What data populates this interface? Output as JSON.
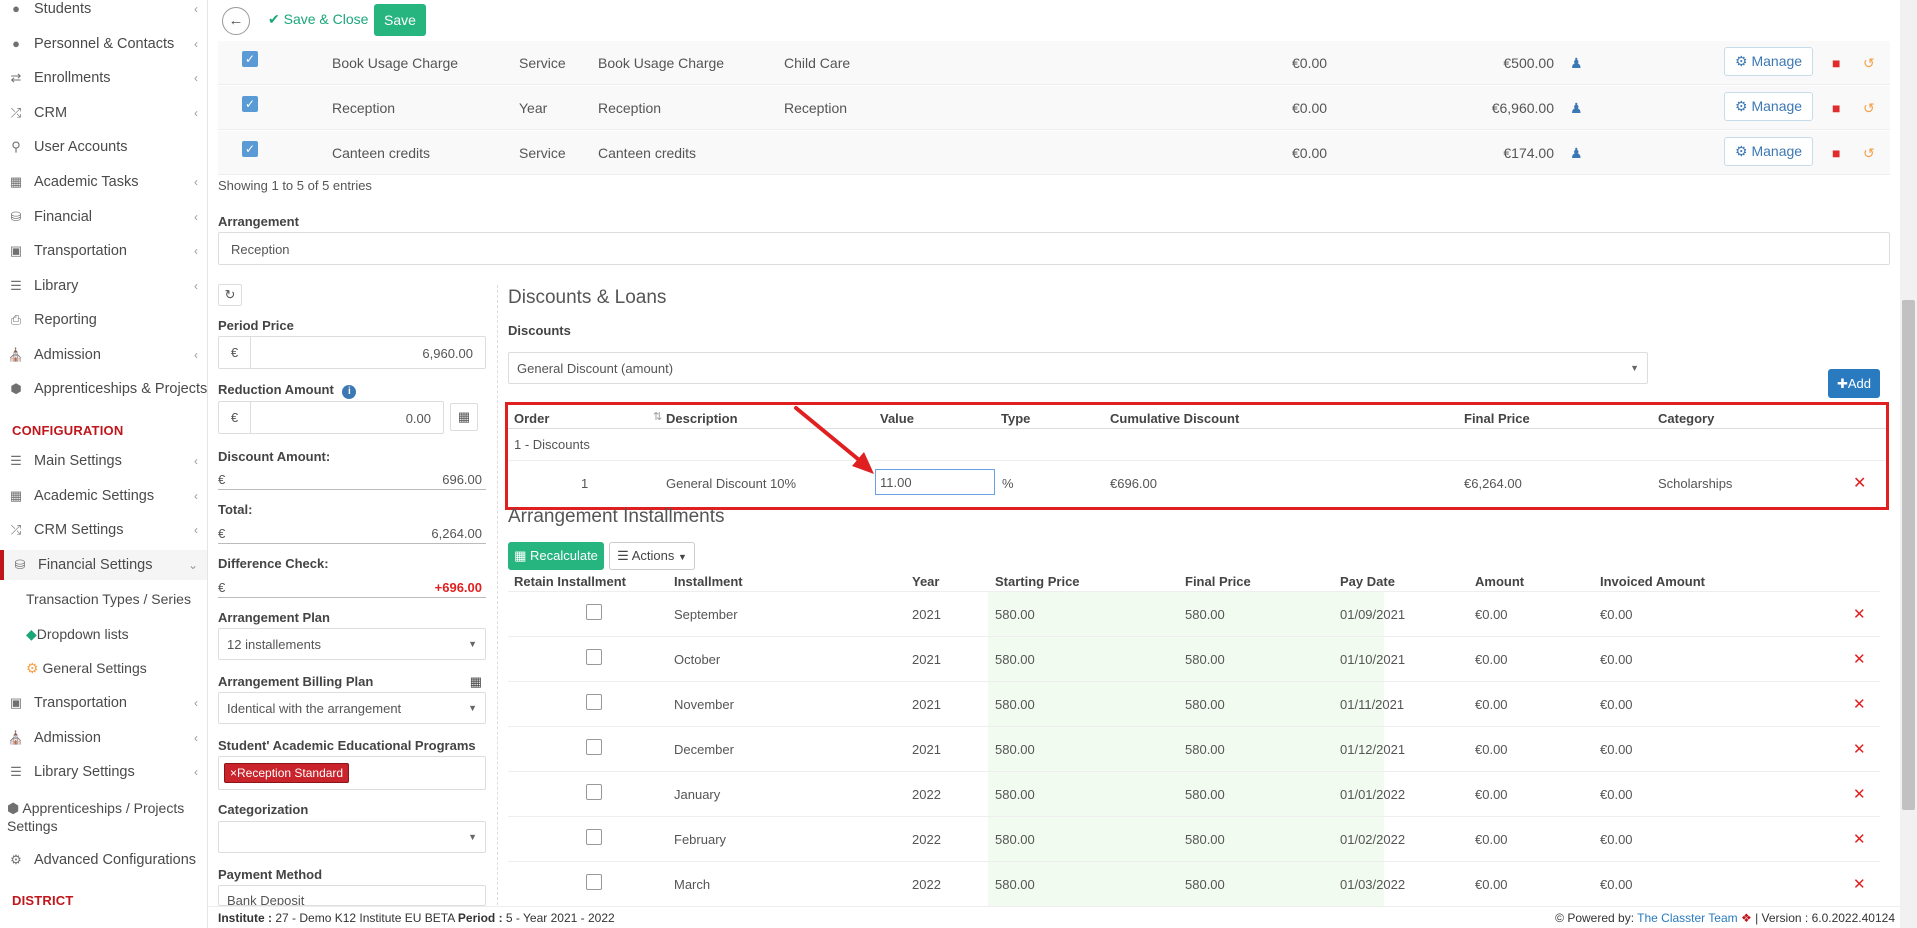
{
  "sidebar": {
    "items": [
      {
        "label": "Students",
        "icon": "users-icon"
      },
      {
        "label": "Personnel & Contacts",
        "icon": "user-icon"
      },
      {
        "label": "Enrollments",
        "icon": "exchange-icon"
      },
      {
        "label": "CRM",
        "icon": "random-icon"
      },
      {
        "label": "User Accounts",
        "icon": "key-icon"
      },
      {
        "label": "Academic Tasks",
        "icon": "grid-icon"
      },
      {
        "label": "Financial",
        "icon": "coins-icon"
      },
      {
        "label": "Transportation",
        "icon": "bus-icon"
      },
      {
        "label": "Library",
        "icon": "books-icon"
      },
      {
        "label": "Reporting",
        "icon": "print-icon"
      },
      {
        "label": "Admission",
        "icon": "institution-icon"
      },
      {
        "label": "Apprenticeships & Projects",
        "icon": "cube-icon"
      }
    ],
    "config_header": "CONFIGURATION",
    "config_items": [
      {
        "label": "Main Settings",
        "icon": "sliders-icon"
      },
      {
        "label": "Academic Settings",
        "icon": "sitemap-icon"
      },
      {
        "label": "CRM Settings",
        "icon": "random-icon"
      },
      {
        "label": "Financial Settings",
        "icon": "coins-icon"
      }
    ],
    "financial_sub": [
      "Transaction Types / Series",
      "Dropdown lists",
      "General Settings"
    ],
    "config_items2": [
      {
        "label": "Transportation",
        "icon": "bus-icon"
      },
      {
        "label": "Admission",
        "icon": "institution-icon"
      },
      {
        "label": "Library Settings",
        "icon": "books-icon"
      }
    ],
    "apprenticeships_settings": "Apprenticeships / Projects Settings",
    "advanced": "Advanced Configurations",
    "district_header": "DISTRICT"
  },
  "toolbar": {
    "save_close_label": "Save & Close",
    "save_label": "Save"
  },
  "services_table": {
    "rows": [
      {
        "name": "Book Usage Charge",
        "type": "Service",
        "desc": "Book Usage Charge",
        "category": "Child Care",
        "discount": "€0.00",
        "amount": "€500.00"
      },
      {
        "name": "Reception",
        "type": "Year",
        "desc": "Reception",
        "category": "Reception",
        "discount": "€0.00",
        "amount": "€6,960.00"
      },
      {
        "name": "Canteen credits",
        "type": "Service",
        "desc": "Canteen credits",
        "category": "",
        "discount": "€0.00",
        "amount": "€174.00"
      }
    ],
    "manage_label": "Manage",
    "showing": "Showing 1 to 5 of 5 entries"
  },
  "arrangement": {
    "label": "Arrangement",
    "value": "Reception"
  },
  "left_form": {
    "period_price_label": "Period Price",
    "period_price": "6,960.00",
    "currency": "€",
    "reduction_label": "Reduction Amount",
    "reduction": "0.00",
    "discount_amount_label": "Discount Amount:",
    "discount_amount": "696.00",
    "total_label": "Total:",
    "total": "6,264.00",
    "difference_label": "Difference Check:",
    "difference": "+696.00",
    "plan_label": "Arrangement Plan",
    "plan": "12 installements",
    "billing_label": "Arrangement Billing Plan",
    "billing": "Identical with the arrangement",
    "programs_label": "Student' Academic Educational Programs",
    "program_tag": "Reception Standard",
    "categorization_label": "Categorization",
    "payment_label": "Payment Method",
    "payment": "Bank Deposit"
  },
  "discounts": {
    "title": "Discounts & Loans",
    "label": "Discounts",
    "selected": "General Discount (amount)",
    "add_label": "Add",
    "headers": [
      "Order",
      "Description",
      "Value",
      "Type",
      "Cumulative Discount",
      "Final Price",
      "Category"
    ],
    "group": "1 - Discounts",
    "row": {
      "order": "1",
      "description": "General Discount 10%",
      "value": "11.00",
      "type": "%",
      "cumulative": "€696.00",
      "final": "€6,264.00",
      "category": "Scholarships"
    }
  },
  "installments": {
    "title": "Arrangement Installments",
    "recalc_label": "Recalculate",
    "actions_label": "Actions",
    "headers": [
      "Retain Installment",
      "Installment",
      "Year",
      "Starting Price",
      "Final Price",
      "Pay Date",
      "Amount",
      "Invoiced Amount"
    ],
    "rows": [
      {
        "month": "September",
        "year": "2021",
        "start": "580.00",
        "final": "580.00",
        "date": "01/09/2021",
        "amount": "€0.00",
        "invoiced": "€0.00"
      },
      {
        "month": "October",
        "year": "2021",
        "start": "580.00",
        "final": "580.00",
        "date": "01/10/2021",
        "amount": "€0.00",
        "invoiced": "€0.00"
      },
      {
        "month": "November",
        "year": "2021",
        "start": "580.00",
        "final": "580.00",
        "date": "01/11/2021",
        "amount": "€0.00",
        "invoiced": "€0.00"
      },
      {
        "month": "December",
        "year": "2021",
        "start": "580.00",
        "final": "580.00",
        "date": "01/12/2021",
        "amount": "€0.00",
        "invoiced": "€0.00"
      },
      {
        "month": "January",
        "year": "2022",
        "start": "580.00",
        "final": "580.00",
        "date": "01/01/2022",
        "amount": "€0.00",
        "invoiced": "€0.00"
      },
      {
        "month": "February",
        "year": "2022",
        "start": "580.00",
        "final": "580.00",
        "date": "01/02/2022",
        "amount": "€0.00",
        "invoiced": "€0.00"
      },
      {
        "month": "March",
        "year": "2022",
        "start": "580.00",
        "final": "580.00",
        "date": "01/03/2022",
        "amount": "€0.00",
        "invoiced": "€0.00"
      }
    ]
  },
  "footer": {
    "institute_label": "Institute :",
    "institute": "27 - Demo K12 Institute EU BETA",
    "period_label": "Period :",
    "period": "5 - Year 2021 - 2022",
    "powered": "Powered by:",
    "team": "The Classter Team",
    "version": "| Version : 6.0.2022.40124"
  },
  "colors": {
    "accent_red": "#c0161b",
    "green": "#26b47f",
    "blue": "#3c78b4"
  }
}
